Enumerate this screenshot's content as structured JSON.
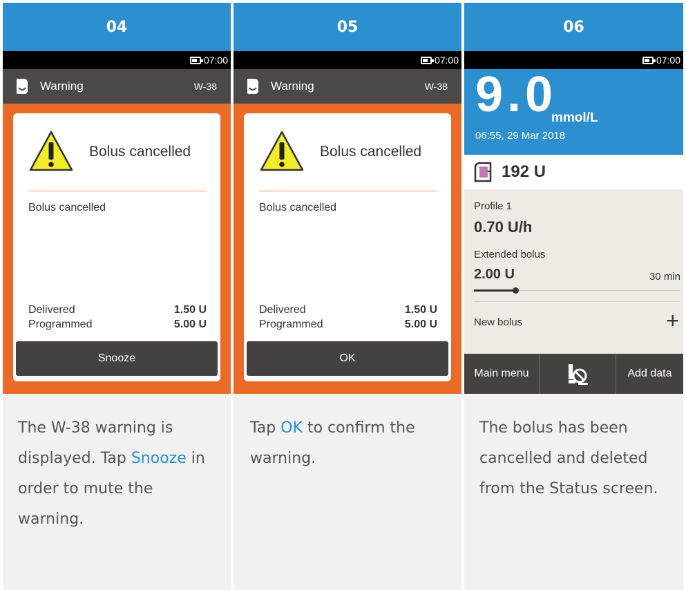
{
  "steps": [
    {
      "number": "04",
      "status_time": "07:00",
      "title_bar": {
        "title": "Warning",
        "code": "W-38"
      },
      "dialog": {
        "title": "Bolus cancelled",
        "message": "Bolus cancelled",
        "delivered_label": "Delivered",
        "delivered_value": "1.50 U",
        "programmed_label": "Programmed",
        "programmed_value": "5.00 U",
        "button_label": "Snooze"
      },
      "caption": {
        "before": "The W-38 warning is displayed. Tap ",
        "highlight": "Snooze",
        "after": " in order to mute the warning."
      }
    },
    {
      "number": "05",
      "status_time": "07:00",
      "title_bar": {
        "title": "Warning",
        "code": "W-38"
      },
      "dialog": {
        "title": "Bolus cancelled",
        "message": "Bolus cancelled",
        "delivered_label": "Delivered",
        "delivered_value": "1.50 U",
        "programmed_label": "Programmed",
        "programmed_value": "5.00 U",
        "button_label": "OK"
      },
      "caption": {
        "before": "Tap ",
        "highlight": "OK",
        "after": " to confirm the warning."
      }
    },
    {
      "number": "06",
      "status_time": "07:00",
      "status_screen": {
        "bg_value": "9.0",
        "bg_unit": "mmol/L",
        "bg_timestamp": "06:55, 29 Mar 2018",
        "reservoir": "192 U",
        "profile_label": "Profile 1",
        "basal_rate": "0.70 U/h",
        "extended_label": "Extended bolus",
        "extended_value": "2.00 U",
        "extended_duration": "30 min",
        "extended_progress": 0.2,
        "new_bolus_label": "New bolus",
        "new_bolus_plus": "+",
        "menu_left": "Main menu",
        "menu_mid_icon": "bolus-stop-icon",
        "menu_right": "Add data"
      },
      "caption": {
        "text": "The bolus has been cancelled and deleted from the Status screen."
      }
    }
  ],
  "colors": {
    "header_blue": "#2b8fd0",
    "warning_orange": "#ea6a27",
    "dark_bar": "#4b4847",
    "beige": "#efebe4",
    "highlight": "#2b8fd0"
  }
}
